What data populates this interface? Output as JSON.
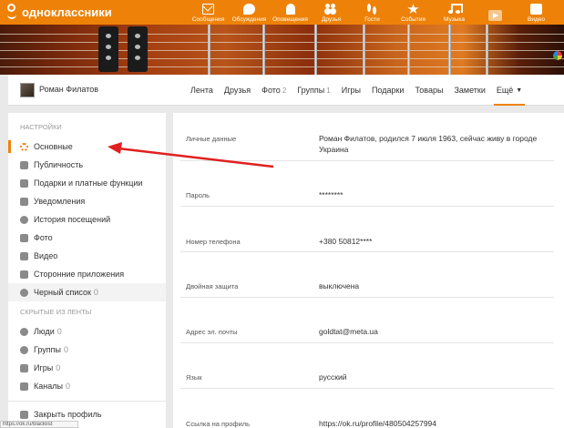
{
  "app": {
    "logo_text": "одноклассники"
  },
  "nav": [
    {
      "label": "Сообщения",
      "icon": "envelope-icon"
    },
    {
      "label": "Обсуждения",
      "icon": "chat-bubble-icon"
    },
    {
      "label": "Оповещения",
      "icon": "bell-icon"
    },
    {
      "label": "Друзья",
      "icon": "friends-icon"
    },
    {
      "label": "Гости",
      "icon": "footprints-icon"
    },
    {
      "label": "События",
      "icon": "star-icon"
    },
    {
      "label": "Музыка",
      "icon": "music-note-icon"
    },
    {
      "label": "",
      "icon": "play-icon"
    },
    {
      "label": "Видео",
      "icon": "video-camera-icon"
    }
  ],
  "profile": {
    "name": "Роман Филатов",
    "tabs": [
      {
        "label": "Лента",
        "count": ""
      },
      {
        "label": "Друзья",
        "count": ""
      },
      {
        "label": "Фото",
        "count": "2"
      },
      {
        "label": "Группы",
        "count": "1"
      },
      {
        "label": "Игры",
        "count": ""
      },
      {
        "label": "Подарки",
        "count": ""
      },
      {
        "label": "Товары",
        "count": ""
      },
      {
        "label": "Заметки",
        "count": ""
      },
      {
        "label": "Ещё",
        "count": ""
      }
    ]
  },
  "sidebar": {
    "settings_header": "НАСТРОЙКИ",
    "settings_items": [
      {
        "label": "Основные",
        "count": ""
      },
      {
        "label": "Публичность",
        "count": ""
      },
      {
        "label": "Подарки и платные функции",
        "count": ""
      },
      {
        "label": "Уведомления",
        "count": ""
      },
      {
        "label": "История посещений",
        "count": ""
      },
      {
        "label": "Фото",
        "count": ""
      },
      {
        "label": "Видео",
        "count": ""
      },
      {
        "label": "Сторонние приложения",
        "count": ""
      },
      {
        "label": "Черный список",
        "count": "0"
      }
    ],
    "hidden_header": "СКРЫТЫЕ ИЗ ЛЕНТЫ",
    "hidden_items": [
      {
        "label": "Люди",
        "count": "0"
      },
      {
        "label": "Группы",
        "count": "0"
      },
      {
        "label": "Игры",
        "count": "0"
      },
      {
        "label": "Каналы",
        "count": "0"
      }
    ],
    "close_profile": "Закрыть профиль"
  },
  "settings": [
    {
      "key": "Личные данные",
      "value": "Роман Филатов, родился 7 июля 1963, сейчас живу в городе Украина"
    },
    {
      "key": "Пароль",
      "value": "********"
    },
    {
      "key": "Номер телефона",
      "value": "+380 50812****"
    },
    {
      "key": "Двойная защита",
      "value": "выключена"
    },
    {
      "key": "Адрес эл. почты",
      "value": "goldtat@meta.ua"
    },
    {
      "key": "Язык",
      "value": "русский"
    },
    {
      "key": "Ссылка на профиль",
      "value": "https://ok.ru/profile/480504257994"
    }
  ],
  "status_url": "https://ok.ru/blacklist",
  "colors": {
    "brand": "#ee8208",
    "annotation_arrow": "#e02020"
  }
}
